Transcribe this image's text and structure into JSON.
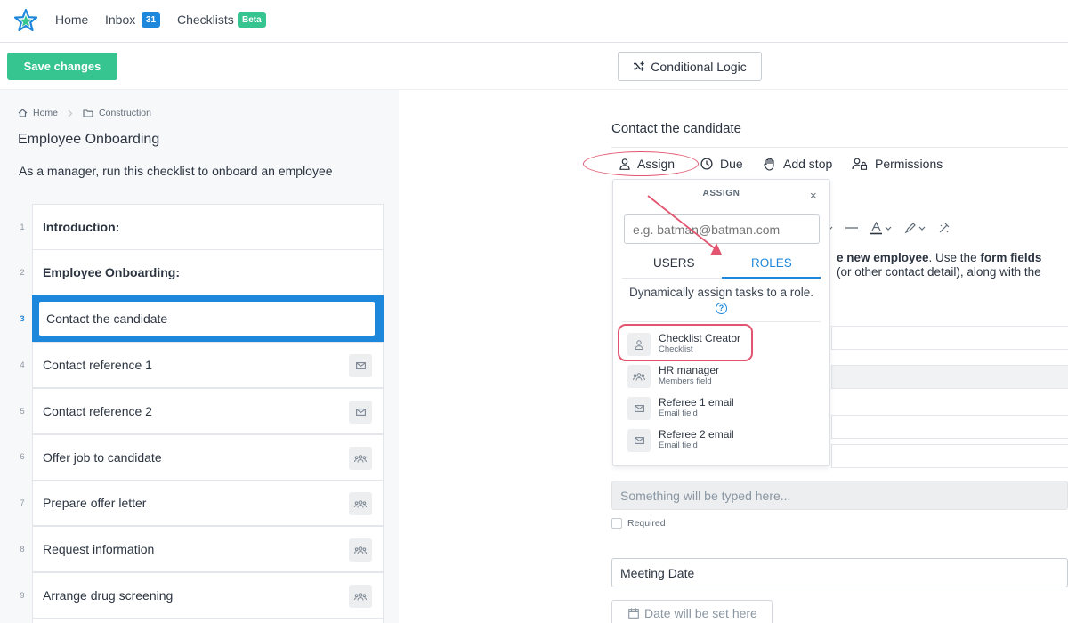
{
  "nav": {
    "home": "Home",
    "inbox": "Inbox",
    "inbox_count": "31",
    "checklists": "Checklists",
    "beta": "Beta"
  },
  "toolbar": {
    "save": "Save changes",
    "conditional_logic": "Conditional Logic"
  },
  "breadcrumb": {
    "home": "Home",
    "folder": "Construction"
  },
  "checklist": {
    "title": "Employee Onboarding",
    "description": "As a manager, run this checklist to onboard an employee"
  },
  "steps": [
    {
      "num": "1",
      "label": "Introduction:",
      "icon": ""
    },
    {
      "num": "2",
      "label": "Employee Onboarding:",
      "icon": ""
    },
    {
      "num": "3",
      "label": "Contact the candidate",
      "icon": ""
    },
    {
      "num": "4",
      "label": "Contact reference 1",
      "icon": "mail-icon"
    },
    {
      "num": "5",
      "label": "Contact reference 2",
      "icon": "mail-icon"
    },
    {
      "num": "6",
      "label": "Offer job to candidate",
      "icon": "group-icon"
    },
    {
      "num": "7",
      "label": "Prepare offer letter",
      "icon": "group-icon"
    },
    {
      "num": "8",
      "label": "Request information",
      "icon": "group-icon"
    },
    {
      "num": "9",
      "label": "Arrange drug screening",
      "icon": "group-icon"
    }
  ],
  "task": {
    "title": "Contact the candidate",
    "actions": {
      "assign": "Assign",
      "due": "Due",
      "add_stop": "Add stop",
      "permissions": "Permissions"
    },
    "body_parts": [
      "e new employee",
      ". Use the ",
      "form fields"
    ],
    "body_line2": "(or other contact detail), along with the",
    "something_placeholder": "Something will be typed here...",
    "required": "Required",
    "meeting_date": "Meeting Date",
    "date_placeholder": "Date will be set here"
  },
  "assign_popup": {
    "title": "ASSIGN",
    "close": "×",
    "placeholder": "e.g. batman@batman.com",
    "tab_users": "USERS",
    "tab_roles": "ROLES",
    "description": "Dynamically assign tasks to a role.",
    "help": "?",
    "roles": [
      {
        "name": "Checklist Creator",
        "type": "Checklist",
        "icon": "person-icon"
      },
      {
        "name": "HR manager",
        "type": "Members field",
        "icon": "group-icon"
      },
      {
        "name": "Referee 1 email",
        "type": "Email field",
        "icon": "mail-icon"
      },
      {
        "name": "Referee 2 email",
        "type": "Email field",
        "icon": "mail-icon"
      }
    ]
  },
  "colors": {
    "accent": "#1d87db",
    "save_green": "#36c490",
    "highlight_red": "#e2546f",
    "beta_green": "#36c490"
  }
}
